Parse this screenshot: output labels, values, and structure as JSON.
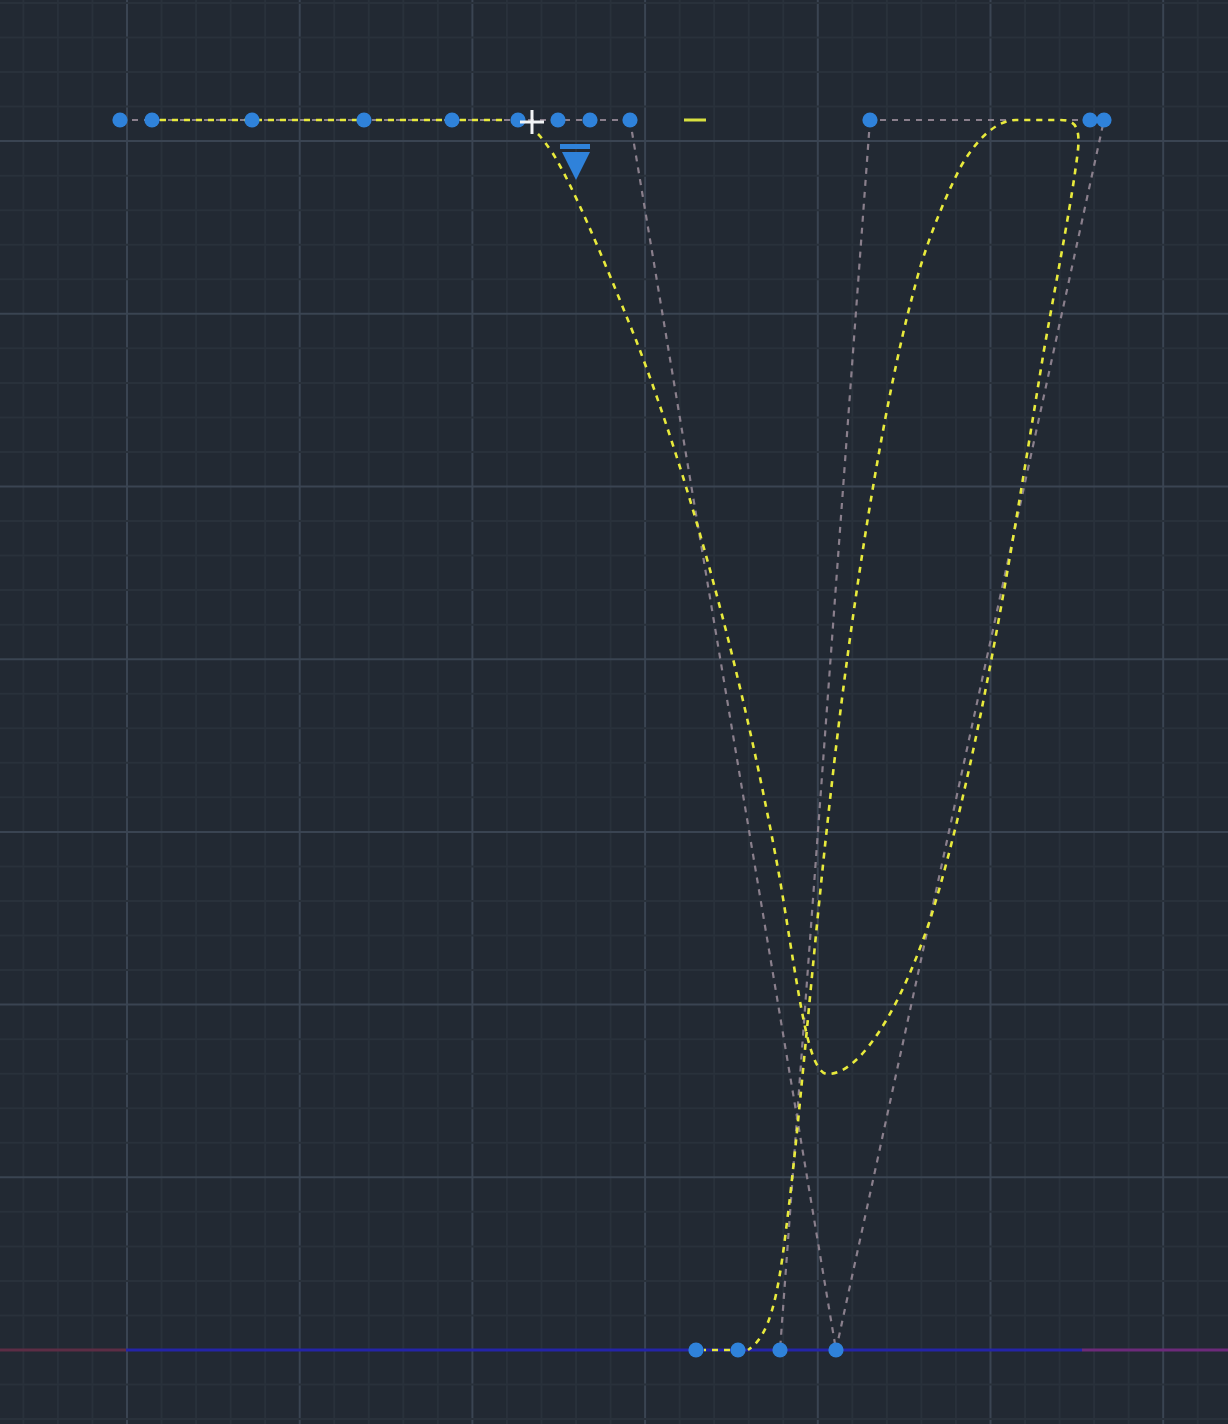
{
  "drawing": {
    "spline": {
      "selected": true,
      "control_frame_visible": true
    }
  }
}
